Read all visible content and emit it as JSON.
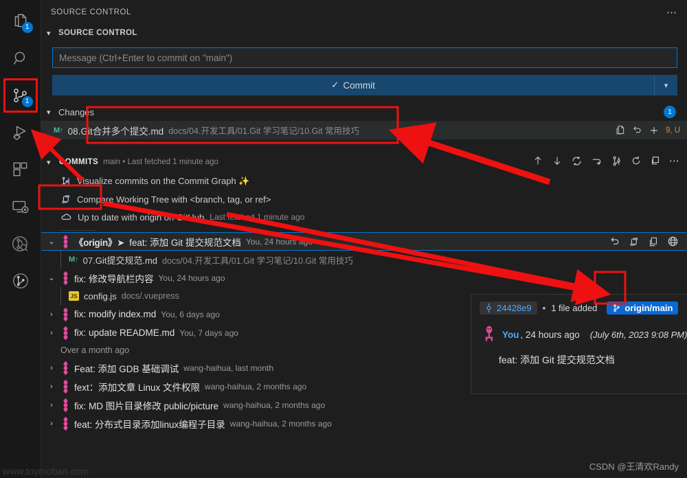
{
  "activity_bar": {
    "items": [
      {
        "name": "explorer",
        "icon": "files-icon",
        "badge": "1",
        "selected": false
      },
      {
        "name": "search",
        "icon": "search-icon",
        "badge": null,
        "selected": false
      },
      {
        "name": "source-control",
        "icon": "source-control-icon",
        "badge": "1",
        "selected": true
      },
      {
        "name": "run-and-debug",
        "icon": "run-debug-icon",
        "badge": null,
        "selected": false
      },
      {
        "name": "extensions",
        "icon": "extensions-icon",
        "badge": null,
        "selected": false
      },
      {
        "name": "remote-explorer",
        "icon": "remote-icon",
        "badge": null,
        "selected": false
      },
      {
        "name": "git-graph-search",
        "icon": "git-lens-search-icon",
        "badge": null,
        "selected": false
      },
      {
        "name": "git-lens",
        "icon": "git-lens-icon",
        "badge": null,
        "selected": false
      }
    ]
  },
  "view": {
    "title": "SOURCE CONTROL",
    "more_actions": "⋯"
  },
  "scm_section": {
    "header": "SOURCE CONTROL",
    "message_placeholder": "Message (Ctrl+Enter to commit on \"main\")",
    "commit_label": "Commit",
    "commit_check": "✓",
    "commit_dropdown": "⌄"
  },
  "changes": {
    "label": "Changes",
    "count": "1",
    "file": {
      "status": "M↑",
      "name": "08.Git合并多个提交.md",
      "path": "docs/04.开发工具/01.Git 学习笔记/10.Git 常用技巧",
      "actions": [
        "open-file-icon",
        "discard-changes-icon",
        "stage-changes-icon"
      ],
      "status_letters": "9, U"
    }
  },
  "commits": {
    "header": "COMMITS",
    "subtitle": "main • Last fetched 1 minute ago",
    "toolbar": [
      {
        "name": "push-icon",
        "glyph": "↑"
      },
      {
        "name": "pull-icon",
        "glyph": "↓"
      },
      {
        "name": "sync-icon",
        "glyph": "sync"
      },
      {
        "name": "fetch-icon",
        "glyph": "fetch"
      },
      {
        "name": "branch-icon",
        "glyph": "branch"
      },
      {
        "name": "refresh-icon",
        "glyph": "refresh"
      },
      {
        "name": "split-view-icon",
        "glyph": "split"
      },
      {
        "name": "more-actions-icon",
        "glyph": "⋯"
      }
    ],
    "actions": [
      {
        "icon": "commit-graph-icon",
        "label": "Visualize commits on the Commit Graph ✨",
        "sub": ""
      },
      {
        "icon": "compare-icon",
        "label": "Compare Working Tree with <branch, tag, or ref>",
        "sub": ""
      },
      {
        "icon": "cloud-icon",
        "label": "Up to date with origin on GitHub",
        "sub": "Last fetched 1 minute ago"
      }
    ],
    "list": [
      {
        "type": "commit",
        "twisty": "⌄",
        "origin_tag": "《origin》➤",
        "message": "feat: 添加 Git 提交规范文档",
        "meta": "You, 24 hours ago",
        "selected": true,
        "row_actions": [
          "revert-icon",
          "compare-icon",
          "copy-icon",
          "open-on-remote-icon"
        ]
      },
      {
        "type": "file",
        "status": "M↑",
        "name": "07.Git提交规范.md",
        "path": "docs/04.开发工具/01.Git 学习笔记/10.Git 常用技巧",
        "badge": "md"
      },
      {
        "type": "commit",
        "twisty": "⌄",
        "origin_tag": "",
        "message": "fix: 修改导航栏内容",
        "meta": "You, 24 hours ago",
        "selected": false
      },
      {
        "type": "file",
        "status": "",
        "name": "config.js",
        "path": "docs/.vuepress",
        "badge": "JS"
      },
      {
        "type": "commit",
        "twisty": "›",
        "origin_tag": "",
        "message": "fix: modify index.md",
        "meta": "You, 6 days ago",
        "selected": false
      },
      {
        "type": "commit",
        "twisty": "›",
        "origin_tag": "",
        "message": "fix: update README.md",
        "meta": "You, 7 days ago",
        "selected": false
      },
      {
        "type": "date-separator",
        "label": "Over a month ago"
      },
      {
        "type": "commit",
        "twisty": "›",
        "origin_tag": "",
        "message": "Feat: 添加 GDB 基础调试",
        "meta": "wang-haihua, last month",
        "selected": false
      },
      {
        "type": "commit",
        "twisty": "›",
        "origin_tag": "",
        "message": "fext：添加文章 Linux 文件权限",
        "meta": "wang-haihua, 2 months ago",
        "selected": false
      },
      {
        "type": "commit",
        "twisty": "›",
        "origin_tag": "",
        "message": "fix: MD 图片目录修改 public/picture",
        "meta": "wang-haihua, 2 months ago",
        "selected": false
      },
      {
        "type": "commit",
        "twisty": "›",
        "origin_tag": "",
        "message": "feat: 分布式目录添加linux编程子目录",
        "meta": "wang-haihua, 2 months ago",
        "selected": false
      }
    ]
  },
  "hover_card": {
    "hash": "24428e9",
    "hash_icon": "commit-node-icon",
    "separator": "•",
    "files_changed": "1 file added",
    "branch": "origin/main",
    "branch_icon": "branch-icon",
    "author": "You",
    "relative_time": ", 24 hours ago",
    "absolute_time": "(July 6th, 2023 9:08 PM)",
    "message": "feat: 添加 Git 提交规范文档"
  },
  "watermarks": {
    "right": "CSDN @王清欢Randy",
    "left": "www.toymoban.com"
  },
  "colors": {
    "accent": "#0078d4",
    "annotation": "#ee1111",
    "commit_button": "#17466e",
    "link": "#4daafc",
    "git_node": "#e24a9c",
    "status_added": "#4ab8a8",
    "status_letters": "#cc8b3c"
  }
}
